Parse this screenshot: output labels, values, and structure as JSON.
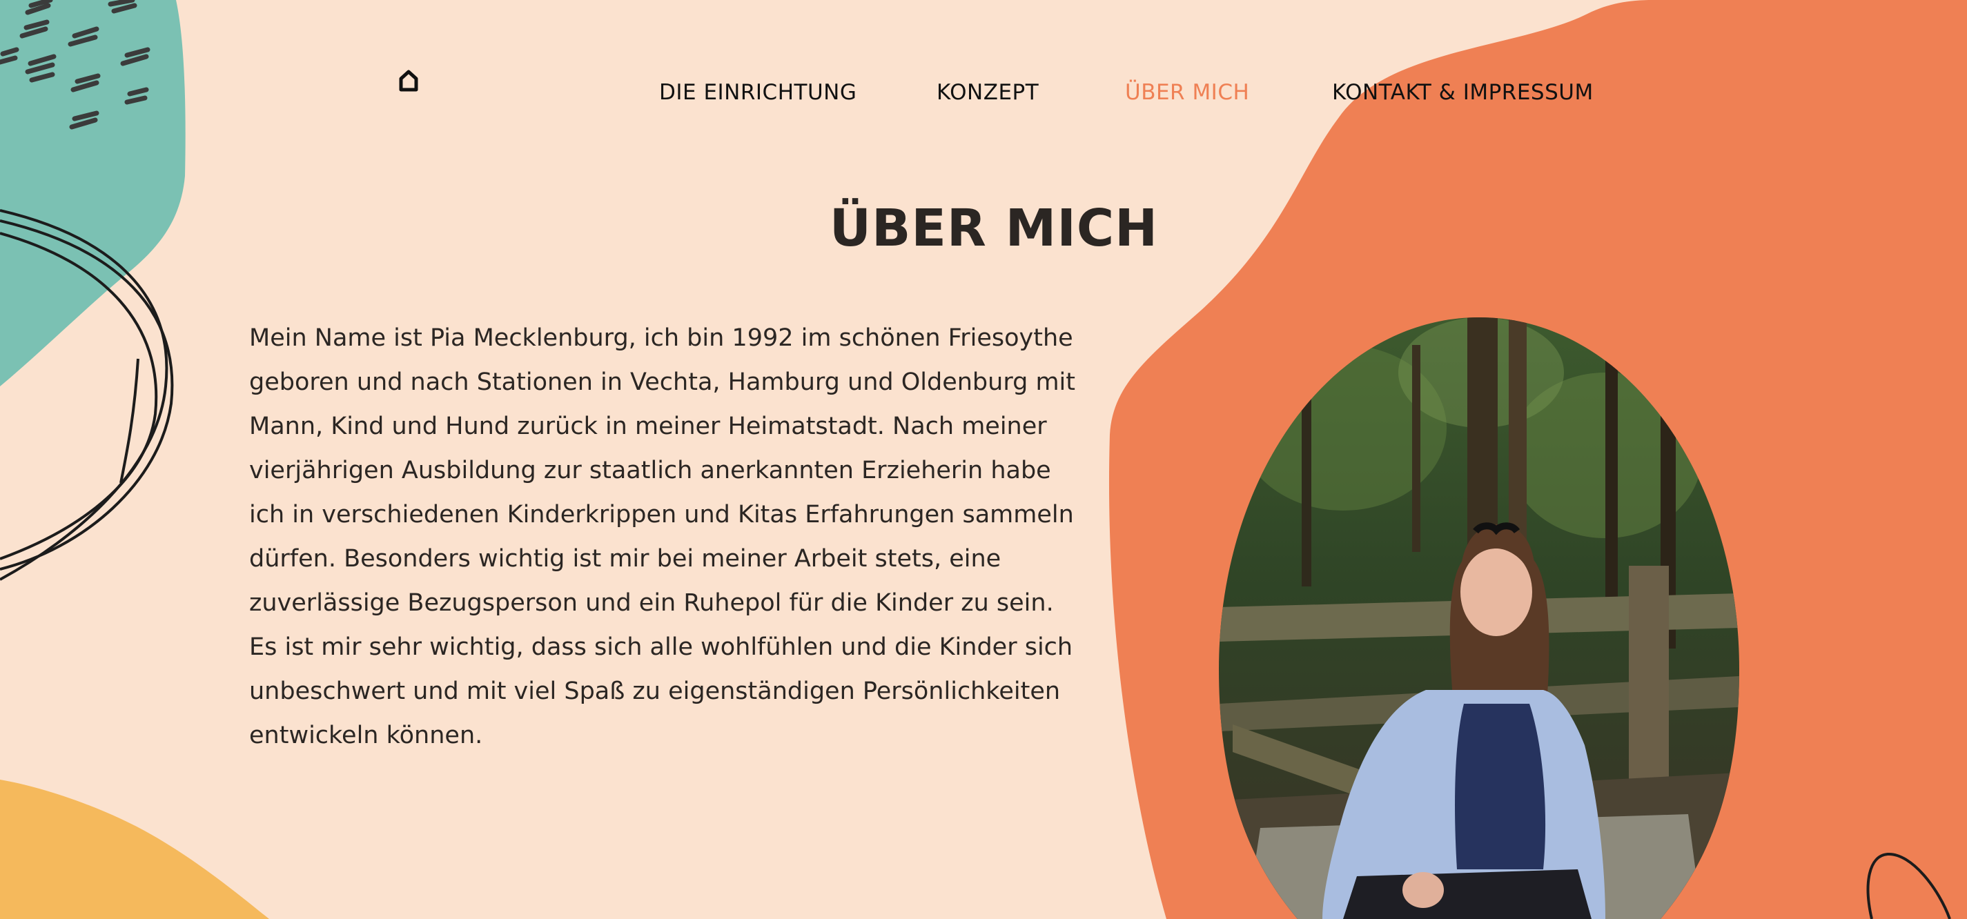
{
  "nav": {
    "home_icon": "home-icon",
    "items": [
      {
        "label": "DIE EINRICHTUNG",
        "active": false
      },
      {
        "label": "KONZEPT",
        "active": false
      },
      {
        "label": "ÜBER MICH",
        "active": true
      },
      {
        "label": "KONTAKT & IMPRESSUM",
        "active": false
      }
    ]
  },
  "page": {
    "title": "ÜBER MICH",
    "bio": "Mein Name ist Pia Mecklenburg, ich bin 1992 im schönen Friesoythe geboren und nach Stationen in Vechta, Hamburg und Oldenburg mit Mann, Kind und Hund zurück in meiner Heimatstadt. Nach meiner vierjährigen Ausbildung zur staatlich anerkannten Erzieherin habe ich in verschiedenen Kinderkrippen und Kitas Erfahrungen sammeln dürfen. Besonders wichtig ist mir bei meiner Arbeit stets, eine zuverlässige Bezugsperson und ein Ruhepol für die Kinder zu sein. Es ist mir sehr wichtig, dass sich alle wohlfühlen und die Kinder sich unbeschwert und mit viel Spaß zu eigenständigen Persönlichkeiten entwickeln können."
  },
  "colors": {
    "background": "#fbe2cf",
    "accent_orange": "#ef8054",
    "teal": "#7bc1b3",
    "yellow": "#f5b95c",
    "text_dark": "#2b2623"
  }
}
